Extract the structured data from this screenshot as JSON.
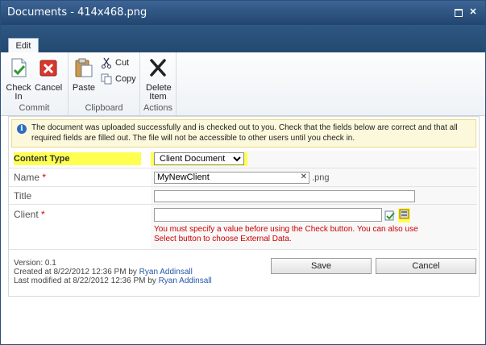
{
  "window": {
    "title": "Documents - 414x468.png"
  },
  "ribbon": {
    "tab_label": "Edit",
    "groups": [
      {
        "label": "Commit",
        "buttons": [
          {
            "label": "Check In",
            "icon": "check-in-icon"
          },
          {
            "label": "Cancel",
            "icon": "cancel-icon"
          }
        ]
      },
      {
        "label": "Clipboard",
        "buttons": [
          {
            "label": "Paste",
            "icon": "paste-icon"
          },
          {
            "label": "Cut",
            "icon": "cut-icon"
          },
          {
            "label": "Copy",
            "icon": "copy-icon"
          }
        ]
      },
      {
        "label": "Actions",
        "buttons": [
          {
            "label": "Delete Item",
            "icon": "delete-icon"
          }
        ]
      }
    ]
  },
  "notice": {
    "icon": "info-icon",
    "text": "The document was uploaded successfully and is checked out to you. Check that the fields below are correct and that all required fields are filled out. The file will not be accessible to other users until you check in."
  },
  "form": {
    "content_type": {
      "label": "Content Type",
      "value": "Client Document"
    },
    "name": {
      "label": "Name",
      "required": "*",
      "value": "MyNewClient",
      "suffix": ".png"
    },
    "title": {
      "label": "Title",
      "value": ""
    },
    "client": {
      "label": "Client",
      "required": "*",
      "value": "",
      "error": "You must specify a value before using the Check button. You can also use Select button to choose External Data."
    }
  },
  "buttons": {
    "save": "Save",
    "cancel": "Cancel"
  },
  "version": {
    "version_text": "Version: 0.1",
    "created_prefix": "Created at 8/22/2012 12:36 PM by",
    "created_by": "Ryan Addinsall",
    "modified_prefix": "Last modified at 8/22/2012 12:36 PM by",
    "modified_by": "Ryan Addinsall"
  },
  "colors": {
    "highlight": "#ffff50",
    "titlebar": "#2e5782",
    "error": "#cc0000",
    "link": "#2357a8"
  }
}
